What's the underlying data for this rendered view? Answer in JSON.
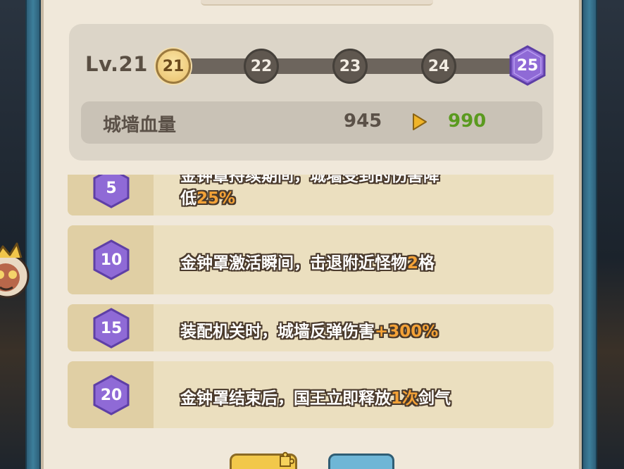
{
  "level": {
    "current_label": "Lv.21",
    "nodes": [
      "21",
      "22",
      "23",
      "24",
      "25"
    ],
    "active_node": "21",
    "milestone_node": "25"
  },
  "stat": {
    "label": "城墙血量",
    "old_value": "945",
    "new_value": "990",
    "arrow_icon": "play-arrow-icon"
  },
  "perks": [
    {
      "level": "5",
      "line1": "金钟罩持续期间，城墙受到的伤害降",
      "line2_prefix": "低",
      "highlight": "25%",
      "suffix": ""
    },
    {
      "level": "10",
      "prefix": "金钟罩激活瞬间，击退附近怪物",
      "highlight": "2",
      "suffix": "格"
    },
    {
      "level": "15",
      "prefix": "装配机关时，城墙反弹伤害",
      "highlight": "+300%",
      "suffix": ""
    },
    {
      "level": "20",
      "prefix": "金钟罩结束后，国王立即释放",
      "highlight": "1次",
      "suffix": "剑气"
    }
  ],
  "colors": {
    "highlight": "#f4a237",
    "new_value": "#5a9a1f",
    "hex_purple": "#8f6ad6"
  }
}
